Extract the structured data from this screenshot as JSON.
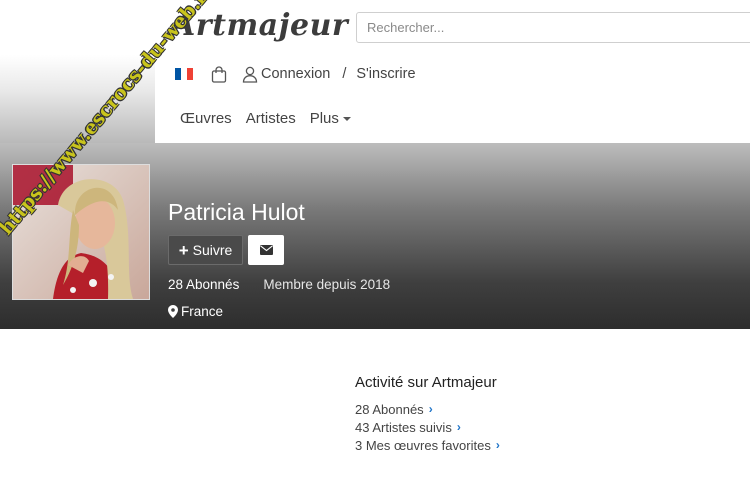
{
  "header": {
    "logo": "Artmajeur",
    "search_placeholder": "Rechercher...",
    "login_label": "Connexion",
    "separator": "/",
    "signup_label": "S'inscrire",
    "nav": [
      {
        "label": "Œuvres"
      },
      {
        "label": "Artistes"
      },
      {
        "label": "Plus"
      }
    ],
    "flag_colors": [
      "#0055a4",
      "#ffffff",
      "#ef4135"
    ]
  },
  "profile": {
    "name": "Patricia Hulot",
    "follow_label": "Suivre",
    "followers": "28 Abonnés",
    "member_since": "Membre depuis 2018",
    "location": "France"
  },
  "activity": {
    "title": "Activité sur Artmajeur",
    "items": [
      {
        "label": "28 Abonnés"
      },
      {
        "label": "43 Artistes suivis"
      },
      {
        "label": "3 Mes œuvres favorites"
      }
    ]
  },
  "watermark": "https://www.escrocs-du-web.fr",
  "colors": {
    "accent": "#1f74c8",
    "watermark": "#c9c41c"
  }
}
